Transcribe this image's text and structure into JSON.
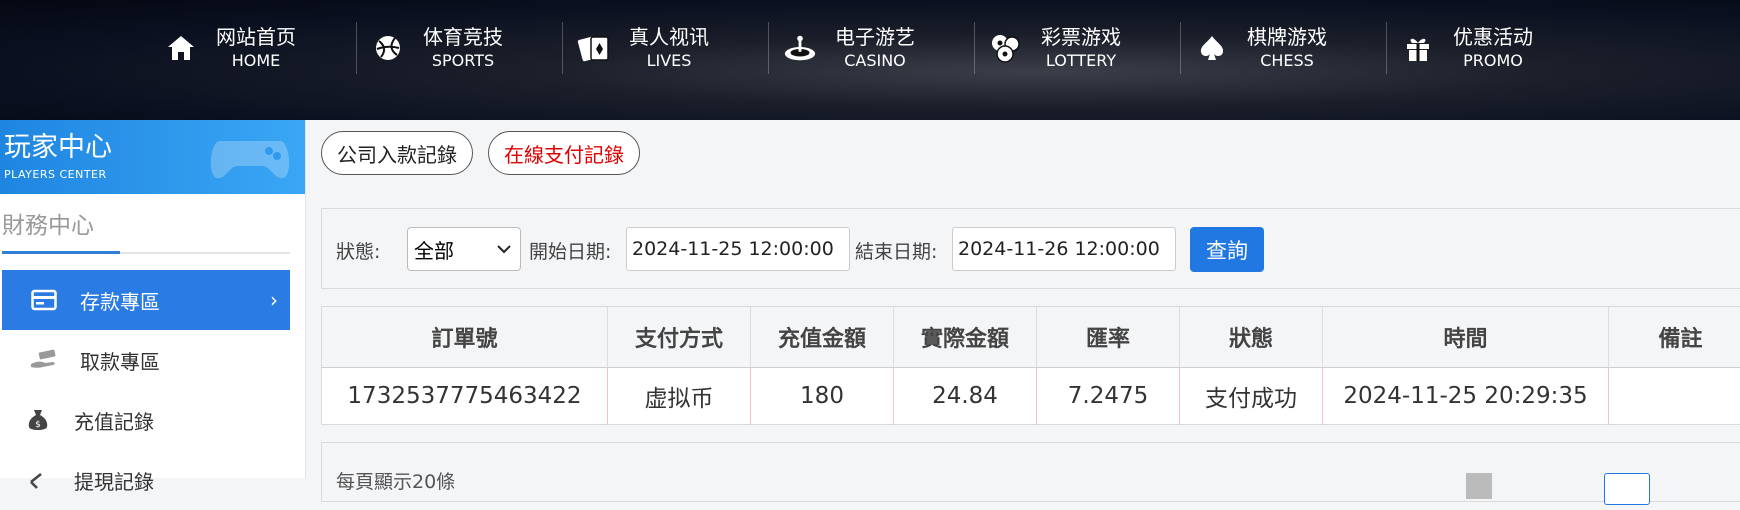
{
  "nav": {
    "items": [
      {
        "zh": "网站首页",
        "en": "HOME",
        "icon": "home-icon"
      },
      {
        "zh": "体育竞技",
        "en": "SPORTS",
        "icon": "ball-icon"
      },
      {
        "zh": "真人视讯",
        "en": "LIVES",
        "icon": "cards-icon"
      },
      {
        "zh": "电子游艺",
        "en": "CASINO",
        "icon": "roulette-icon"
      },
      {
        "zh": "彩票游戏",
        "en": "LOTTERY",
        "icon": "lottery-balls-icon"
      },
      {
        "zh": "棋牌游戏",
        "en": "CHESS",
        "icon": "spade-icon"
      },
      {
        "zh": "优惠活动",
        "en": "PROMO",
        "icon": "gift-icon"
      }
    ]
  },
  "sidebar": {
    "banner_zh": "玩家中心",
    "banner_en": "PLAYERS CENTER",
    "section_title": "財務中心",
    "items": [
      {
        "label": "存款專區",
        "icon": "card-icon",
        "active": true
      },
      {
        "label": "取款專區",
        "icon": "hand-money-icon",
        "active": false
      },
      {
        "label": "充值記錄",
        "icon": "money-bag-icon",
        "active": false
      },
      {
        "label": "提現記錄",
        "icon": "withdraw-icon",
        "active": false
      }
    ]
  },
  "tabs": {
    "company": "公司入款記錄",
    "online": "在線支付記錄"
  },
  "filter": {
    "status_label": "狀態:",
    "status_value": "全部",
    "start_label": "開始日期:",
    "start_value": "2024-11-25 12:00:00",
    "end_label": "結束日期:",
    "end_value": "2024-11-26 12:00:00",
    "query_button": "查詢"
  },
  "table": {
    "headers": [
      "訂單號",
      "支付方式",
      "充值金額",
      "實際金額",
      "匯率",
      "狀態",
      "時間",
      "備註"
    ],
    "rows": [
      [
        "1732537775463422",
        "虚拟币",
        "180",
        "24.84",
        "7.2475",
        "支付成功",
        "2024-11-25 20:29:35",
        ""
      ]
    ]
  },
  "footer": {
    "per_page": "每頁顯示20條"
  },
  "colors": {
    "accent": "#2278e3",
    "online_tab_text": "#e00000"
  }
}
